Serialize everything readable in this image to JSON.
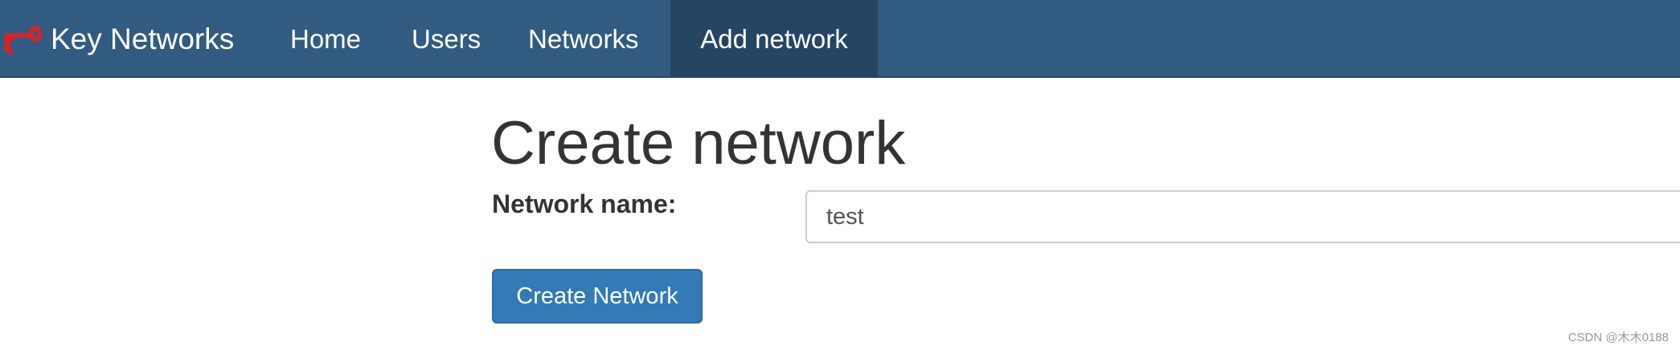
{
  "navbar": {
    "brand_icon": "key-icon",
    "brand_icon_color": "#e02020",
    "brand_text": "Key Networks",
    "items": [
      {
        "label": "Home"
      },
      {
        "label": "Users"
      },
      {
        "label": "Networks"
      },
      {
        "label": "Add network",
        "active": true
      }
    ],
    "background_color": "#325b82",
    "active_color": "#254563"
  },
  "main": {
    "title": "Create network",
    "form": {
      "network_name_label": "Network name:",
      "network_name_value": "test",
      "submit_label": "Create Network"
    }
  },
  "watermark": "CSDN @木木0188"
}
